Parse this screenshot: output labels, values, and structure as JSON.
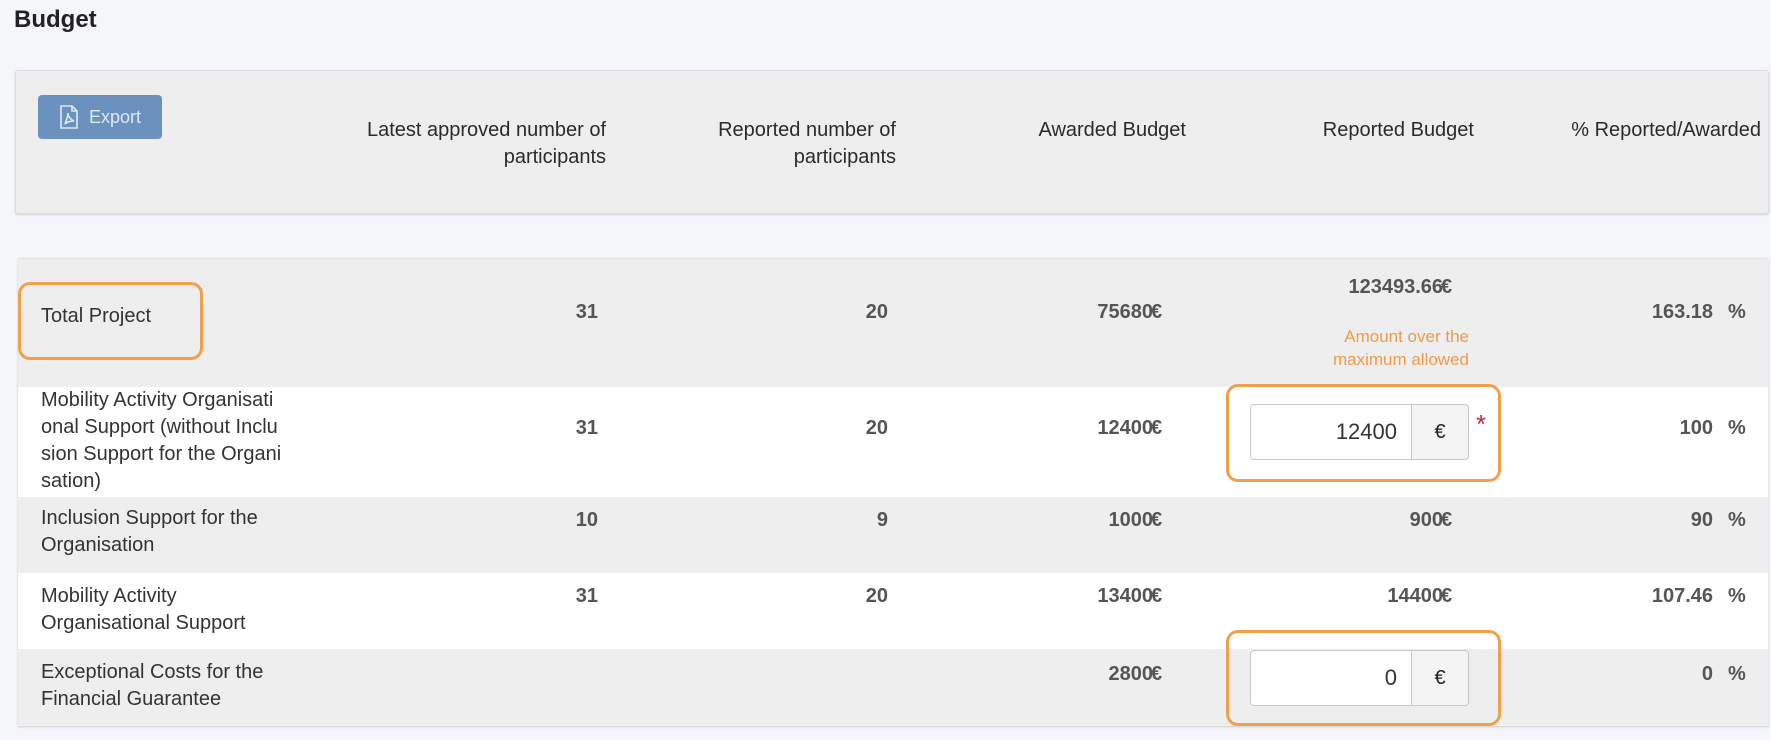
{
  "page": {
    "title": "Budget"
  },
  "toolbar": {
    "export_label": "Export",
    "export_icon": "pdf-file-icon"
  },
  "columns": [
    {
      "line1": "Latest approved number of",
      "line2": "participants"
    },
    {
      "line1": "Reported number of",
      "line2": "participants"
    },
    {
      "line1": "Awarded Budget",
      "line2": ""
    },
    {
      "line1": "Reported Budget",
      "line2": ""
    },
    {
      "line1": "% Reported/Awarded",
      "line2": ""
    }
  ],
  "currency_symbol": "€",
  "percent_symbol": "%",
  "required_marker": "*",
  "rows": [
    {
      "label_lines": [
        "Total Project"
      ],
      "approved": "31",
      "reported": "20",
      "awarded": "75680",
      "reported_budget": "123493.66",
      "warning_line1": "Amount over the",
      "warning_line2": "maximum allowed",
      "percent": "163.18"
    },
    {
      "label_lines": [
        "Mobility Activity Organisati",
        "onal Support (without Inclu",
        "sion Support for the Organi",
        "sation)"
      ],
      "approved": "31",
      "reported": "20",
      "awarded": "12400",
      "reported_budget_input": "12400",
      "percent": "100"
    },
    {
      "label_lines": [
        "Inclusion Support for the",
        "Organisation"
      ],
      "approved": "10",
      "reported": "9",
      "awarded": "1000",
      "reported_budget": "900",
      "percent": "90"
    },
    {
      "label_lines": [
        "Mobility Activity",
        "Organisational Support"
      ],
      "approved": "31",
      "reported": "20",
      "awarded": "13400",
      "reported_budget": "14400",
      "percent": "107.46"
    },
    {
      "label_lines": [
        "Exceptional Costs for the",
        "Financial Guarantee"
      ],
      "approved": "",
      "reported": "",
      "awarded": "2800",
      "reported_budget_input": "0",
      "percent": "0"
    }
  ],
  "colors": {
    "highlight": "#f0a04b",
    "warning": "#ef9a4a",
    "export_button": "#6b92bf",
    "required": "#c0304a"
  }
}
